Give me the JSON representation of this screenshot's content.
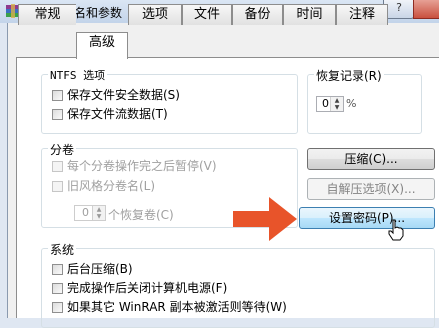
{
  "window": {
    "title": "压缩文件名和参数",
    "help_label": "?"
  },
  "tabs": [
    {
      "label": "常规"
    },
    {
      "label": "高级"
    },
    {
      "label": "选项"
    },
    {
      "label": "文件"
    },
    {
      "label": "备份"
    },
    {
      "label": "时间"
    },
    {
      "label": "注释"
    }
  ],
  "ntfs": {
    "legend": "NTFS 选项",
    "items": [
      {
        "label": "保存文件安全数据(S)",
        "checked": false
      },
      {
        "label": "保存文件流数据(T)",
        "checked": false
      }
    ]
  },
  "recovery": {
    "legend": "恢复记录(R)",
    "value": "0",
    "unit": "%"
  },
  "volumes": {
    "legend": "分卷",
    "items": [
      {
        "label": "每个分卷操作完之后暂停(V)",
        "checked": false,
        "enabled": false
      },
      {
        "label": "旧风格分卷名(L)",
        "checked": false,
        "enabled": false
      }
    ],
    "spin_value": "0",
    "spin_label": "个恢复卷(C)"
  },
  "buttons": {
    "compress": "压缩(C)...",
    "sfx": "自解压选项(X)...",
    "password": "设置密码(P)..."
  },
  "system": {
    "legend": "系统",
    "items": [
      {
        "label": "后台压缩(B)",
        "checked": false
      },
      {
        "label": "完成操作后关闭计算机电源(F)",
        "checked": false
      },
      {
        "label": "如果其它 WinRAR 副本被激活则等待(W)",
        "checked": false
      }
    ]
  },
  "colors": {
    "arrow": "#e8542a",
    "active_tab": "#ffffff",
    "panel_border": "#8d8d8d"
  },
  "icons": {
    "app": "winrar-books-icon",
    "arrow": "arrow-right-icon",
    "cursor": "hand-cursor-icon"
  }
}
